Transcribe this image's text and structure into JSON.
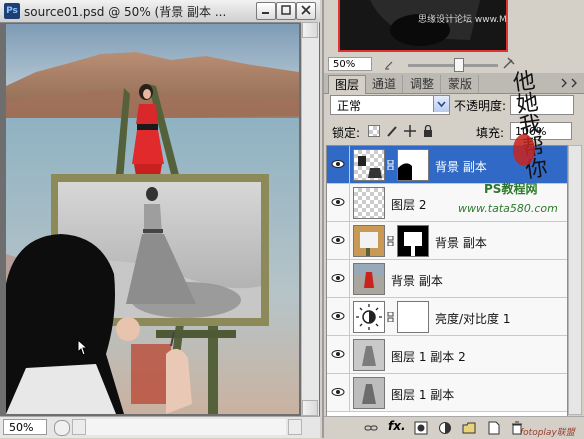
{
  "document": {
    "title": "source01.psd @ 50% (背景 副本 ...",
    "app_icon_text": "Ps",
    "zoom": "50%"
  },
  "navigator": {
    "zoom": "50%",
    "slider_level_fraction": 0.55,
    "thumb_caption": "思缘设计论坛 www.MISSYUAN.COM"
  },
  "layers_panel": {
    "tabs": [
      {
        "label": "图层",
        "active": true
      },
      {
        "label": "通道",
        "active": false
      },
      {
        "label": "调整",
        "active": false
      },
      {
        "label": "蒙版",
        "active": false
      }
    ],
    "blend_mode": "正常",
    "opacity_label": "不透明度:",
    "lock_label": "锁定:",
    "fill_label": "填充:",
    "fill_value": "100%",
    "layers": [
      {
        "name": "背景 副本",
        "selected": true,
        "thumb": "photo-checker",
        "mask": true
      },
      {
        "name": "图层 2",
        "selected": false,
        "thumb": "checker",
        "mask": false
      },
      {
        "name": "背景 副本",
        "selected": false,
        "thumb": "frame",
        "mask": true
      },
      {
        "name": "背景 副本",
        "selected": false,
        "thumb": "photo",
        "mask": false
      },
      {
        "name": "亮度/对比度 1",
        "selected": false,
        "thumb": "adjustment",
        "mask": true
      },
      {
        "name": "图层 1 副本 2",
        "selected": false,
        "thumb": "sketch",
        "mask": false
      },
      {
        "name": "图层 1 副本",
        "selected": false,
        "thumb": "sketch",
        "mask": false
      }
    ]
  },
  "watermark": {
    "calligraphy": "他她我帮你",
    "site_title": "PS教程网",
    "site_url": "www.tata580.com",
    "footer": "fotoplay联盟"
  },
  "colors": {
    "selection": "#3169c6",
    "panel": "#d4d0c8",
    "stamp_red": "#c8231d"
  }
}
